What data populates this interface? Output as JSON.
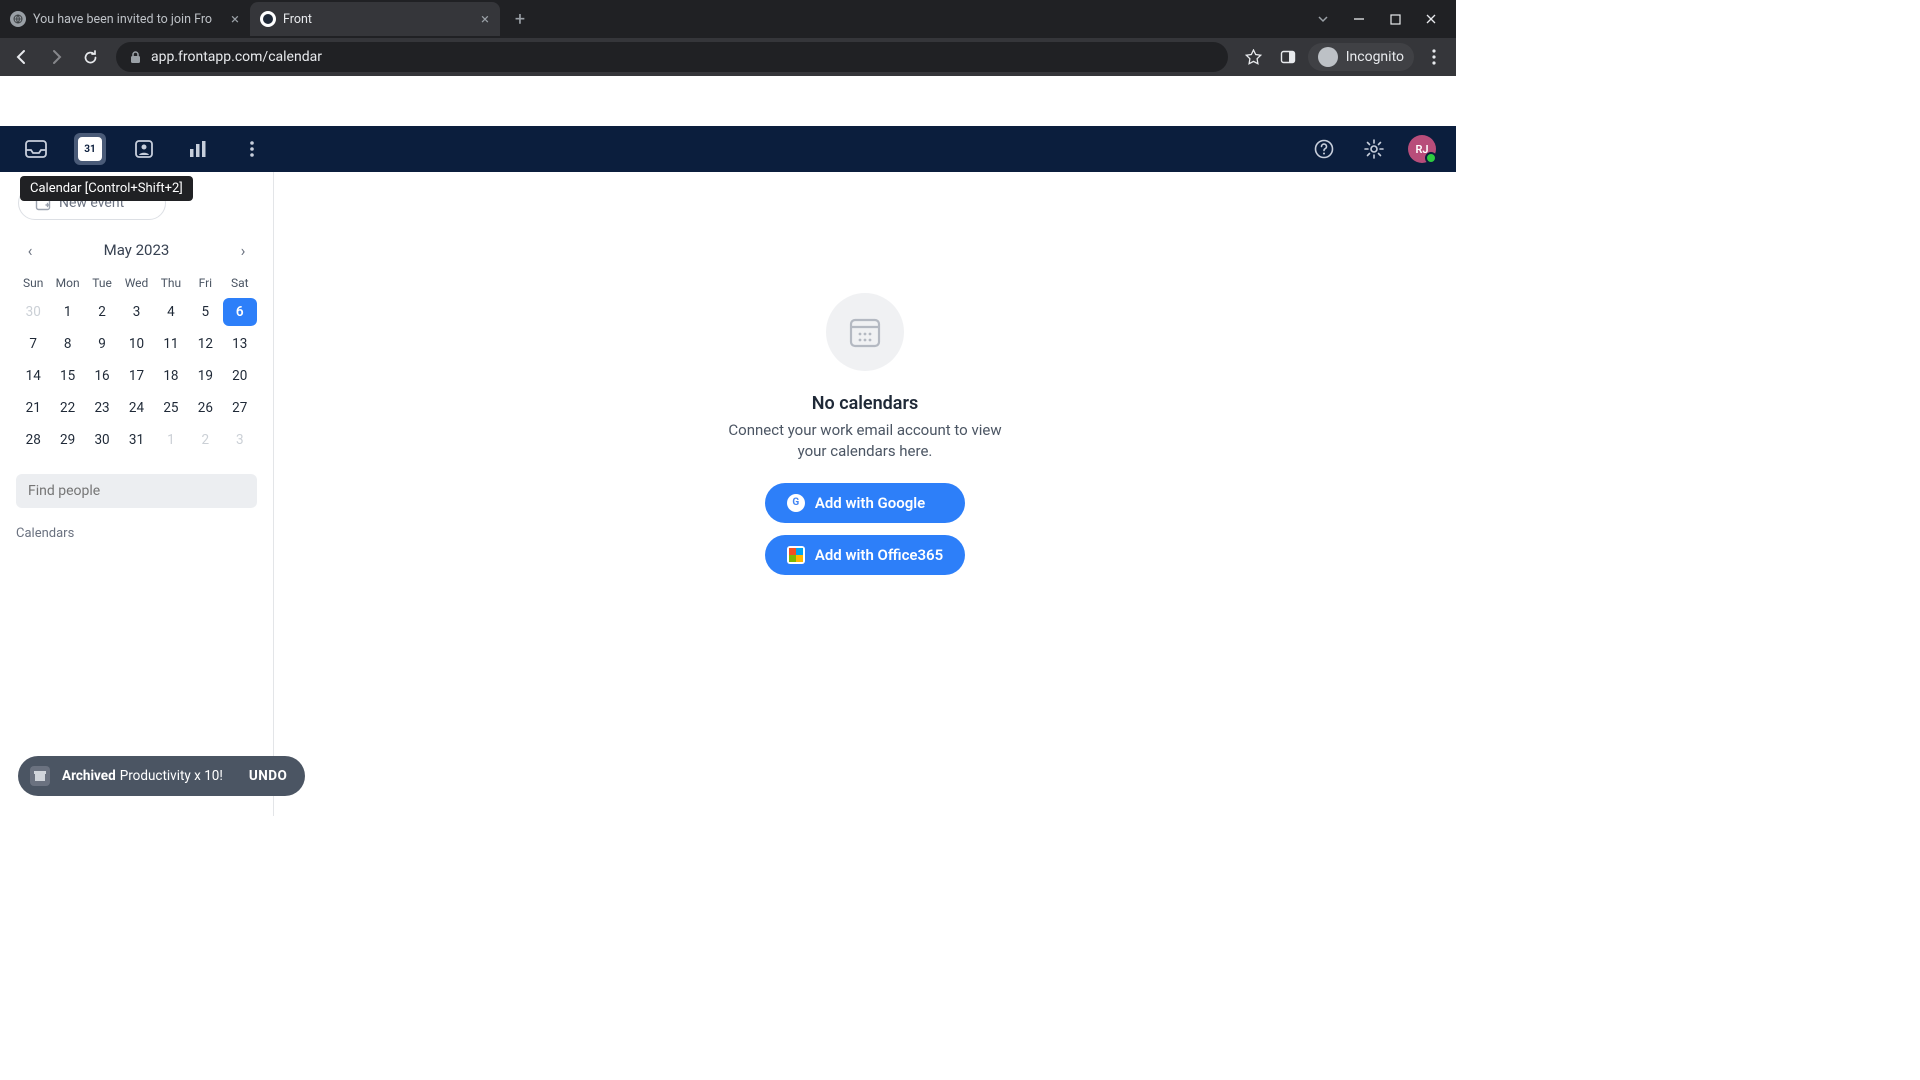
{
  "browser": {
    "tabs": [
      {
        "title": "You have been invited to join Fro",
        "active": false
      },
      {
        "title": "Front",
        "active": true
      }
    ],
    "url": "app.frontapp.com/calendar",
    "incognito_label": "Incognito"
  },
  "appbar": {
    "calendar_day": "31",
    "tooltip": "Calendar [Control+Shift+2]",
    "avatar_initials": "RJ"
  },
  "sidebar": {
    "new_event_label": "New event",
    "month_label": "May 2023",
    "dow": [
      "Sun",
      "Mon",
      "Tue",
      "Wed",
      "Thu",
      "Fri",
      "Sat"
    ],
    "days": [
      {
        "n": "30",
        "other": true
      },
      {
        "n": "1"
      },
      {
        "n": "2"
      },
      {
        "n": "3"
      },
      {
        "n": "4"
      },
      {
        "n": "5"
      },
      {
        "n": "6",
        "selected": true
      },
      {
        "n": "7"
      },
      {
        "n": "8"
      },
      {
        "n": "9"
      },
      {
        "n": "10"
      },
      {
        "n": "11"
      },
      {
        "n": "12"
      },
      {
        "n": "13"
      },
      {
        "n": "14"
      },
      {
        "n": "15"
      },
      {
        "n": "16"
      },
      {
        "n": "17"
      },
      {
        "n": "18"
      },
      {
        "n": "19"
      },
      {
        "n": "20"
      },
      {
        "n": "21"
      },
      {
        "n": "22"
      },
      {
        "n": "23"
      },
      {
        "n": "24"
      },
      {
        "n": "25"
      },
      {
        "n": "26"
      },
      {
        "n": "27"
      },
      {
        "n": "28"
      },
      {
        "n": "29"
      },
      {
        "n": "30"
      },
      {
        "n": "31"
      },
      {
        "n": "1",
        "other": true
      },
      {
        "n": "2",
        "other": true
      },
      {
        "n": "3",
        "other": true
      }
    ],
    "find_placeholder": "Find people",
    "calendars_label": "Calendars"
  },
  "empty": {
    "title": "No calendars",
    "desc": "Connect your work email account to view your calendars here.",
    "google_label": "Add with Google",
    "office_label": "Add with Office365"
  },
  "toast": {
    "bold": "Archived",
    "msg": "Productivity x 10!",
    "undo": "UNDO"
  }
}
